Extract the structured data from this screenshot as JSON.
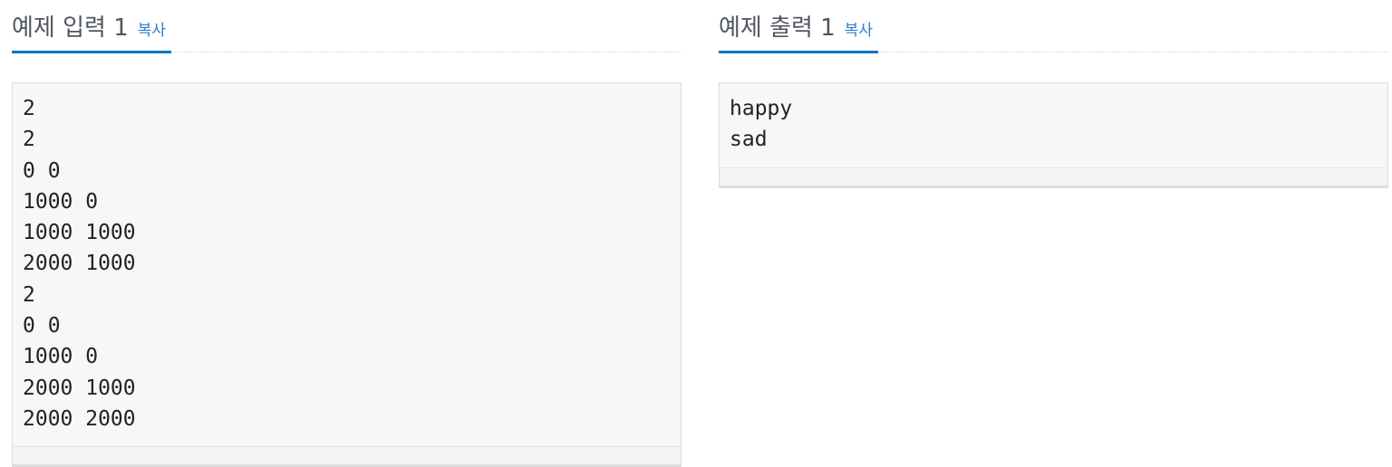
{
  "sample_input": {
    "title": "예제 입력 1",
    "copy_label": "복사",
    "content": "2\n2\n0 0\n1000 0\n1000 1000\n2000 1000\n2\n0 0\n1000 0\n2000 1000\n2000 2000"
  },
  "sample_output": {
    "title": "예제 출력 1",
    "copy_label": "복사",
    "content": "happy\nsad"
  },
  "colors": {
    "accent": "#0076c0",
    "link": "#2a7fc9"
  }
}
